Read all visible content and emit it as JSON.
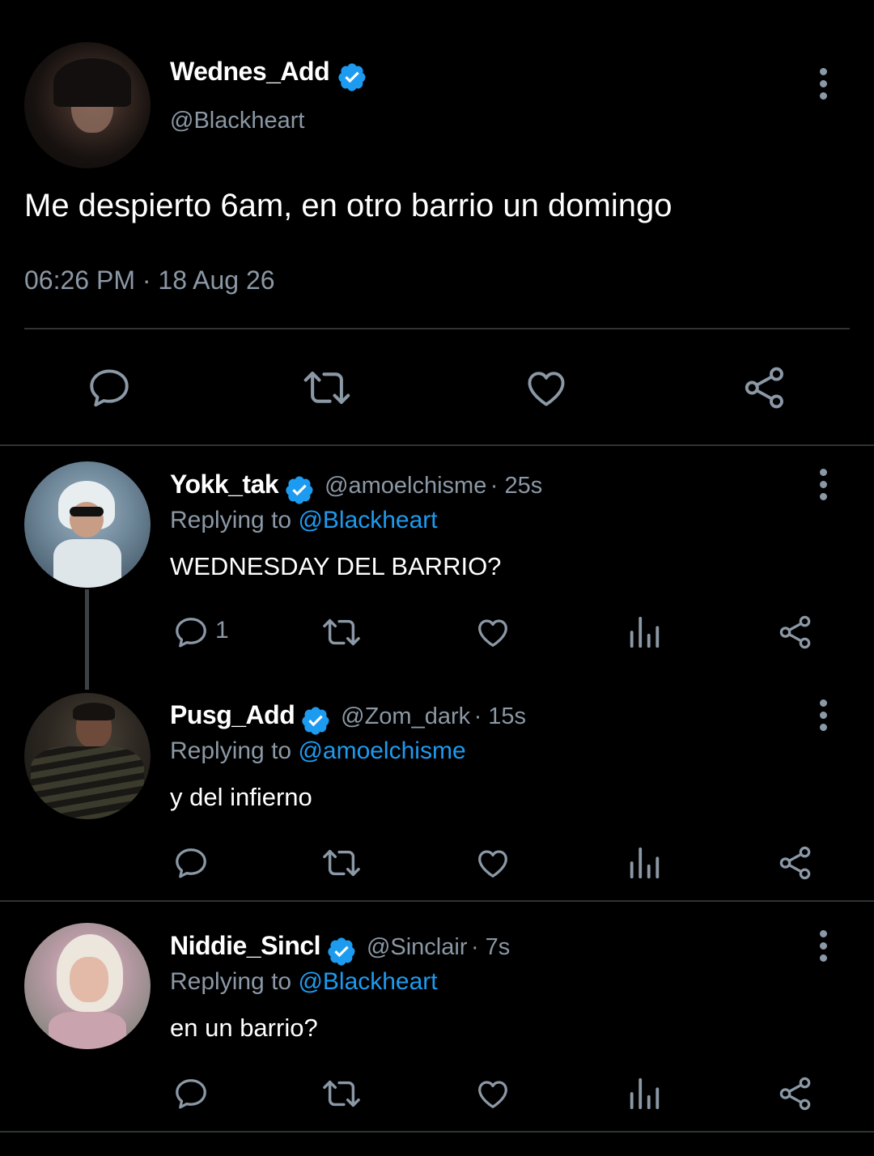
{
  "main_tweet": {
    "name": "Wednes_Add",
    "handle": "@Blackheart",
    "text": "Me despierto 6am, en otro barrio un domingo",
    "timestamp": "06:26 PM · 18 Aug 26"
  },
  "replies": [
    {
      "name": "Yokk_tak",
      "handle": "@amoelchisme",
      "time": "· 25s",
      "replying_prefix": "Replying to",
      "replying_to": "@Blackheart",
      "text": "WEDNESDAY DEL BARRIO?",
      "reply_count": "1"
    },
    {
      "name": "Pusg_Add",
      "handle": "@Zom_dark",
      "time": "· 15s",
      "replying_prefix": "Replying to",
      "replying_to": "@amoelchisme",
      "text": "y del infierno",
      "reply_count": ""
    },
    {
      "name": "Niddie_Sincl",
      "handle": "@Sinclair",
      "time": "· 7s",
      "replying_prefix": "Replying to",
      "replying_to": "@Blackheart",
      "text": "en un barrio?",
      "reply_count": ""
    }
  ],
  "colors": {
    "background": "#000000",
    "accent": "#1d9bf0",
    "muted": "#8b98a5",
    "divider": "#2f3336"
  },
  "icons": [
    "verified-badge-icon",
    "more-icon",
    "reply-icon",
    "retweet-icon",
    "like-icon",
    "share-icon",
    "analytics-icon"
  ]
}
